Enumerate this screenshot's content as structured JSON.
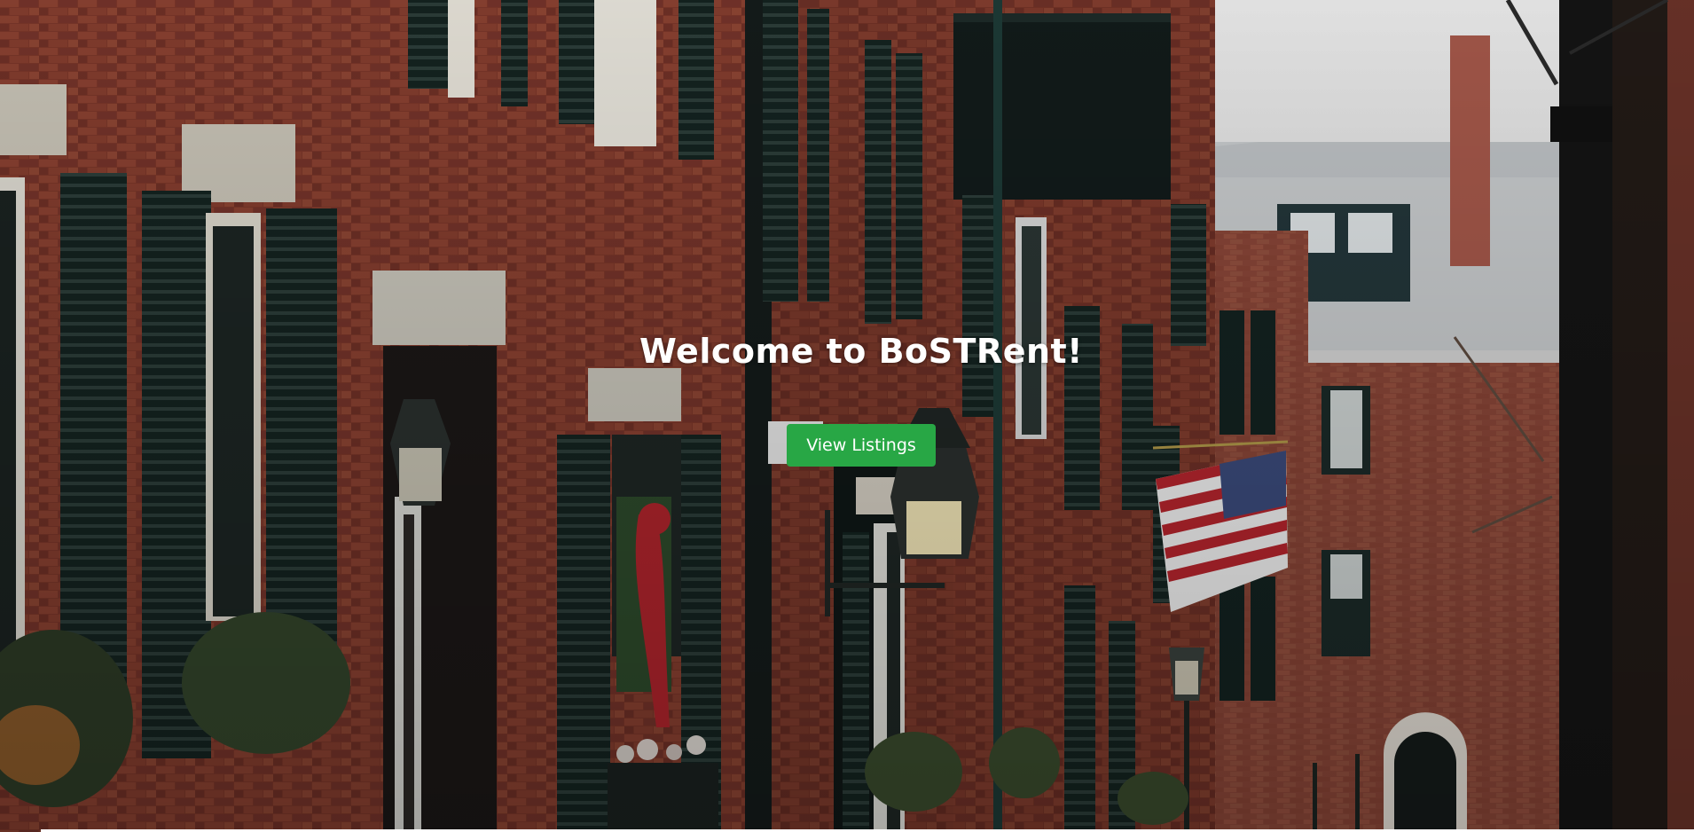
{
  "hero": {
    "title": "Welcome to BoSTRent!",
    "cta_label": "View Listings",
    "cta_color": "#28a745",
    "background_image": "brick-rowhouse-street-photo"
  },
  "colors": {
    "brick": "#7e3a2c",
    "shutter": "#15221f",
    "sky": "#e9eaea",
    "title_text": "#ffffff"
  }
}
